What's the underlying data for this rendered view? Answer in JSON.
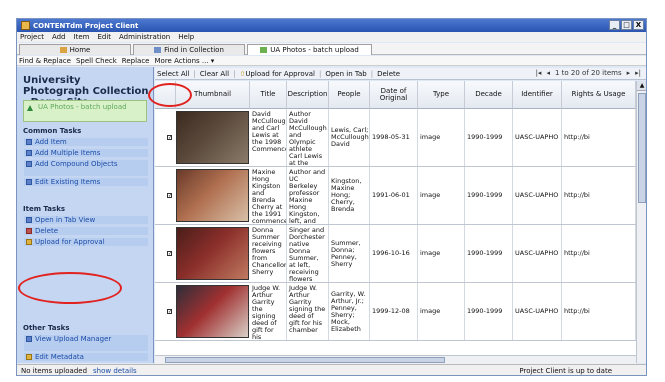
{
  "window": {
    "title": "CONTENTdm Project Client",
    "controls": [
      "_",
      "□",
      "X"
    ]
  },
  "menu": [
    "Project",
    "Add",
    "Item",
    "Edit",
    "Administration",
    "Help"
  ],
  "tabs": [
    {
      "label": "Home"
    },
    {
      "label": "Find in Collection"
    },
    {
      "label": "UA Photos - batch upload"
    }
  ],
  "toolbar": [
    "Find & Replace",
    "Spell Check",
    "Replace",
    "More Actions ... ▾"
  ],
  "sidebar": {
    "collection_title": "University Photograph Collection - Demo Site",
    "batch_label": "UA Photos - batch upload",
    "common_tasks_title": "Common Tasks",
    "common_tasks": [
      "Add Item",
      "Add Multiple Items",
      "Add Compound Objects",
      "Edit Existing Items"
    ],
    "item_tasks_title": "Item Tasks",
    "item_tasks": [
      "Open in Tab View",
      "Delete",
      "Upload for Approval"
    ],
    "other_tasks_title": "Other Tasks",
    "other_tasks": [
      "View Upload Manager",
      "Edit Metadata"
    ]
  },
  "grid_toolbar": {
    "select_all": "Select All",
    "clear_all": "Clear All",
    "upload": "Upload for Approval",
    "open_tab": "Open in Tab",
    "delete": "Delete",
    "pager_text": "1 to 20 of 20 items"
  },
  "columns": [
    "Thumbnail",
    "Title",
    "Description",
    "People",
    "Date of Original",
    "Type",
    "Decade",
    "Identifier",
    "Rights & Usage"
  ],
  "rows": [
    {
      "title": "David McCullough and Carl Lewis at the 1998 Commenceme",
      "description": "Author David McCullough and Olympic athlete Carl Lewis at the 1998",
      "people": "Lewis, Carl; McCullough, David",
      "date": "1998-05-31",
      "type": "image",
      "decade": "1990-1999",
      "identifier": "UASC-UAPHO",
      "rights": "http://bi",
      "photo_colors": [
        "#3c2a1e",
        "#5b4a3c",
        "#8a7a68"
      ]
    },
    {
      "title": "Maxine Hong Kingston and Brenda Cherry at the 1991 commencemen",
      "description": "Author and UC Berkeley professor Maxine Hong Kingston, left, and Dean of",
      "people": "Kingston, Maxine Hong; Cherry, Brenda",
      "date": "1991-06-01",
      "type": "image",
      "decade": "1990-1999",
      "identifier": "UASC-UAPHO",
      "rights": "http://bi",
      "photo_colors": [
        "#6a3a2a",
        "#b07050",
        "#d8c0a8"
      ]
    },
    {
      "title": "Donna Summer receiving flowers from Chancellor Sherry",
      "description": "Singer and Dorchester native Donna Summer, at left, receiving flowers from",
      "people": "Summer, Donna; Penney, Sherry",
      "date": "1996-10-16",
      "type": "image",
      "decade": "1990-1999",
      "identifier": "UASC-UAPHO",
      "rights": "http://bi",
      "photo_colors": [
        "#4a1e1a",
        "#8a2e2a",
        "#c07a60"
      ]
    },
    {
      "title": "Judge W. Arthur Garrity the signing deed of gift for his chamber",
      "description": "Judge W. Arthur Garrity signing the deed of gift for his chamber",
      "people": "Garrity, W. Arthur, Jr.; Penney, Sherry; Mock, Elizabeth",
      "date": "1999-12-08",
      "type": "image",
      "decade": "1990-1999",
      "identifier": "UASC-UAPHO",
      "rights": "http://bi",
      "photo_colors": [
        "#2e2e3a",
        "#a03030",
        "#d8d0c8"
      ]
    }
  ],
  "status": {
    "left": "No items uploaded",
    "link": "show details",
    "right": "Project Client is up to date"
  },
  "accent_colors": {
    "title_bar": "#2a55b0",
    "sidebar": "#c4d6f2",
    "annotation": "#e2221e"
  }
}
